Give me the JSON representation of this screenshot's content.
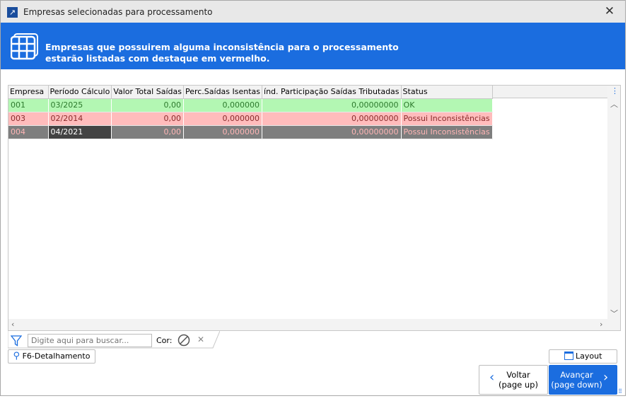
{
  "window": {
    "title": "Empresas selecionadas para processamento"
  },
  "banner": {
    "line1": "Empresas que possuirem alguma inconsistência para o processamento",
    "line2": "estarão listadas com destaque em vermelho."
  },
  "table": {
    "columns": [
      "Empresa",
      "Período Cálculo",
      "Valor Total Saídas",
      "Perc.Saídas Isentas",
      "índ. Participação Saídas Tributadas",
      "Status"
    ],
    "rows": [
      {
        "empresa": "001",
        "periodo": "03/2025",
        "valor": "0,00",
        "perc": "0,000000",
        "ind": "0,00000000",
        "status": "OK"
      },
      {
        "empresa": "003",
        "periodo": "02/2014",
        "valor": "0,00",
        "perc": "0,000000",
        "ind": "0,00000000",
        "status": "Possui Inconsistências"
      },
      {
        "empresa": "004",
        "periodo": "04/2021",
        "valor": "0,00",
        "perc": "0,000000",
        "ind": "0,00000000",
        "status": "Possui Inconsistências"
      }
    ]
  },
  "filter": {
    "placeholder": "Digite aqui para buscar...",
    "color_label": "Cor:"
  },
  "buttons": {
    "detail": "F6-Detalhamento",
    "layout": "Layout",
    "back_1": "Voltar",
    "back_2": "(page up)",
    "next_1": "Avançar",
    "next_2": "(page down)"
  },
  "colors": {
    "accent": "#1b6ddf",
    "ok": "#b3f7b3",
    "error": "#ffbcbc"
  }
}
